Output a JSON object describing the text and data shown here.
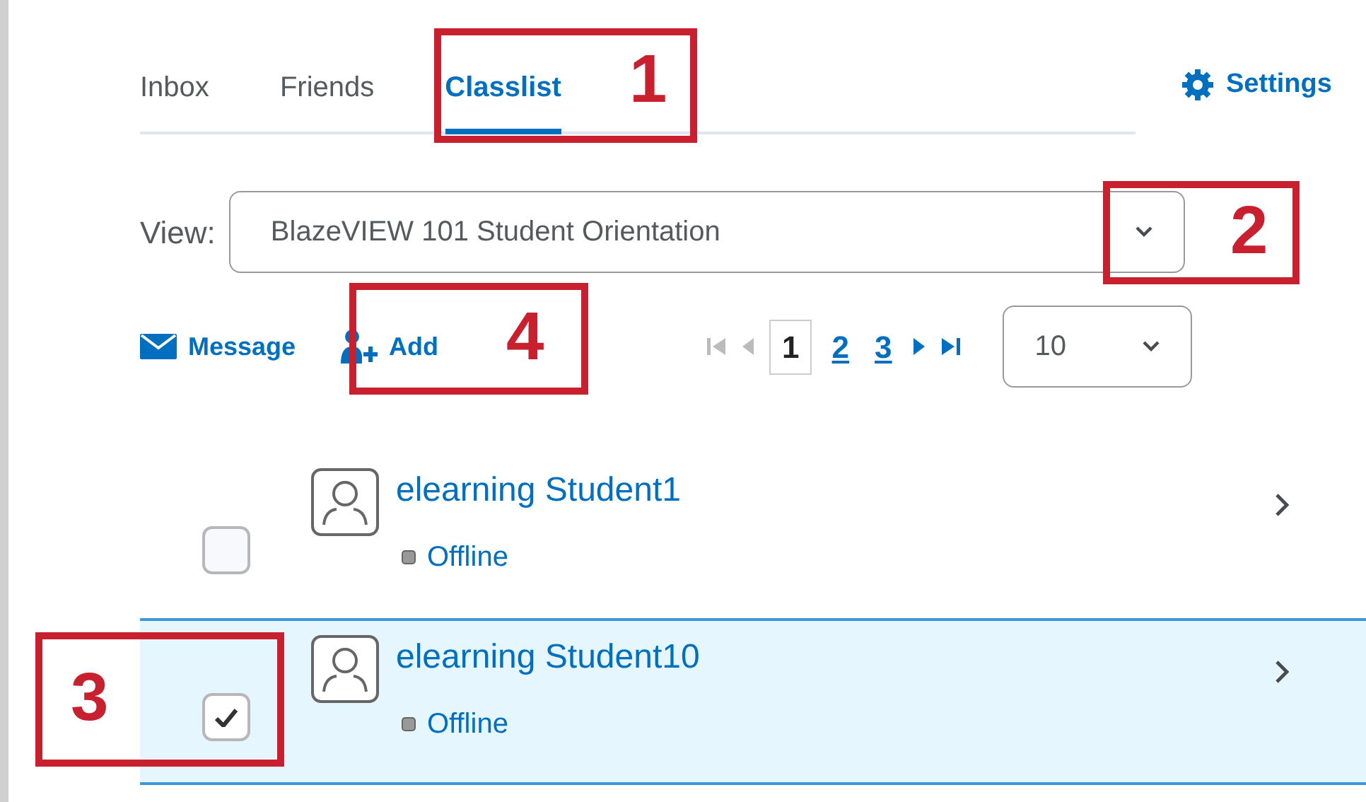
{
  "tabs": [
    {
      "label": "Inbox",
      "selected": false
    },
    {
      "label": "Friends",
      "selected": false
    },
    {
      "label": "Classlist",
      "selected": true
    }
  ],
  "settings": {
    "label": "Settings"
  },
  "view": {
    "label": "View:",
    "value": "BlazeVIEW 101 Student Orientation"
  },
  "actions": [
    {
      "label": "Message",
      "kind": "message"
    },
    {
      "label": "Add",
      "kind": "add"
    }
  ],
  "pages": [
    {
      "label": "1",
      "selected": true
    },
    {
      "label": "2",
      "selected": false
    },
    {
      "label": "3",
      "selected": false
    }
  ],
  "page_size": {
    "value": "10"
  },
  "students": [
    {
      "name": "elearning Student1",
      "status": "Offline",
      "checked": false,
      "selected": false
    },
    {
      "name": "elearning Student10",
      "status": "Offline",
      "checked": true,
      "selected": true
    }
  ],
  "callouts": [
    {
      "number": "1",
      "kind": "tab"
    },
    {
      "number": "2",
      "kind": "view"
    },
    {
      "number": "3",
      "kind": "checkbox"
    },
    {
      "number": "4",
      "kind": "add"
    }
  ]
}
